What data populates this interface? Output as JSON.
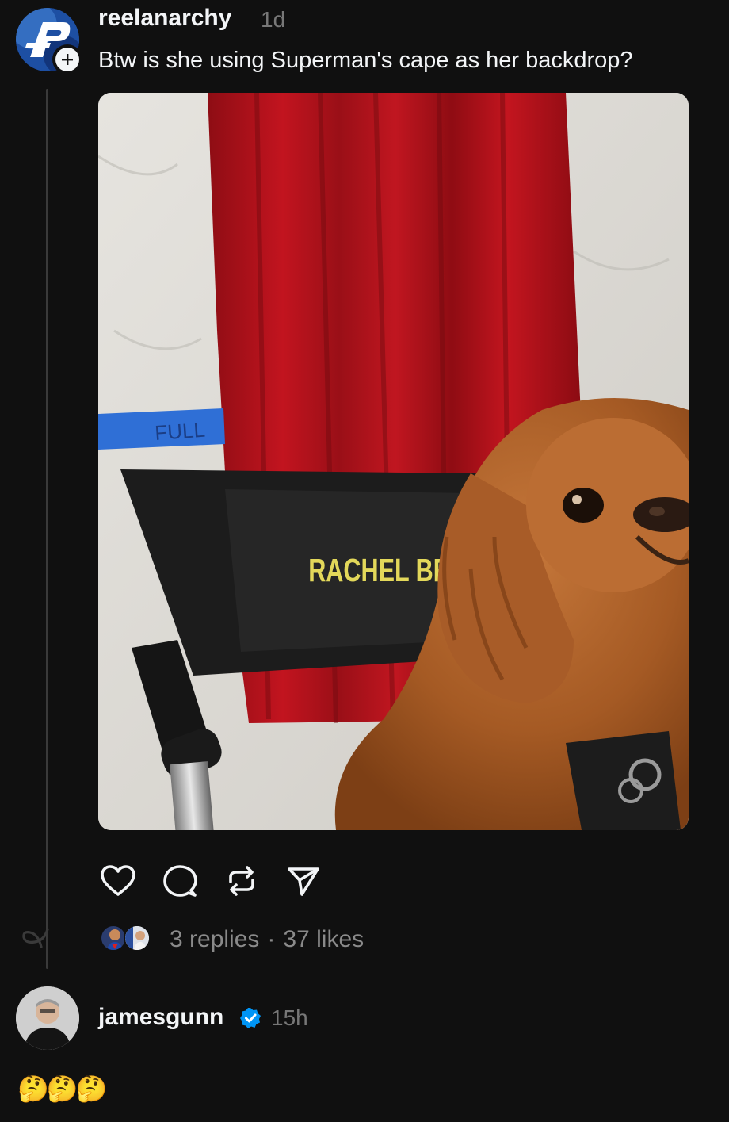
{
  "post": {
    "username": "reelanarchy",
    "timestamp": "1d",
    "text": "Btw is she using Superman's cape as her backdrop?",
    "image": {
      "chair_label": "RACHEL BR",
      "tape_label": "FULL"
    },
    "actions": {
      "like_icon": "heart-icon",
      "reply_icon": "comment-icon",
      "repost_icon": "repost-icon",
      "share_icon": "send-icon"
    },
    "stats": {
      "replies": "3 replies",
      "separator": "·",
      "likes": "37 likes"
    }
  },
  "reply": {
    "username": "jamesgunn",
    "timestamp": "15h",
    "text": "🤔🤔🤔"
  },
  "colors": {
    "background": "#101010",
    "text": "#f3f5f7",
    "muted": "#777777",
    "verified": "#0095f6",
    "cape_red": "#b0121c"
  }
}
